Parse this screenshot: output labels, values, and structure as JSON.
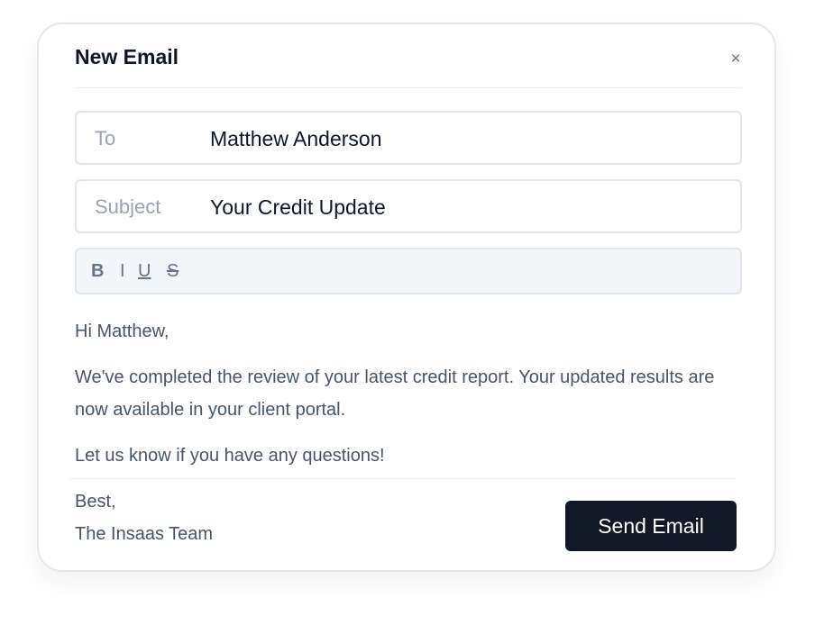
{
  "dialog": {
    "title": "New Email",
    "close_symbol": "×",
    "close_icon": "close-icon"
  },
  "fields": {
    "to": {
      "label": "To",
      "value": "Matthew Anderson"
    },
    "subject": {
      "label": "Subject",
      "value": "Your Credit Update"
    }
  },
  "toolbar": {
    "bold": "B",
    "italic": "I",
    "underline": "U",
    "strikethrough": "S"
  },
  "message": {
    "greeting": "Hi Matthew,",
    "paragraph": "We've completed the review of your latest credit report. Your updated results are now available in your client portal.",
    "closing_line": "Let us know if you have any questions!",
    "signoff": "Best,",
    "signature": "The Insaas Team"
  },
  "actions": {
    "send_label": "Send Email"
  },
  "colors": {
    "primary_button": "#111827",
    "title_text": "#0f172a",
    "body_text": "#475569",
    "muted_label": "#9aa3b0",
    "border": "#e2e6ee",
    "toolbar_bg": "#f3f5f8"
  }
}
